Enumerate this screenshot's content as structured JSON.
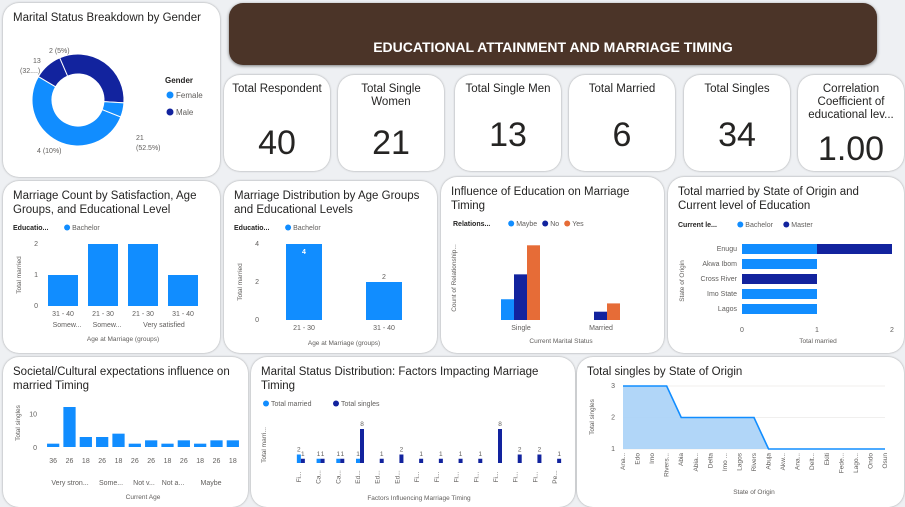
{
  "header": {
    "title": "EDUCATIONAL ATTAINMENT AND MARRIAGE TIMING"
  },
  "kpis": [
    {
      "label": "Total Respondent",
      "value": "40"
    },
    {
      "label": "Total Single Women",
      "value": "21"
    },
    {
      "label": "Total Single Men",
      "value": "13"
    },
    {
      "label": "Total Married",
      "value": "6"
    },
    {
      "label": "Total Singles",
      "value": "34"
    },
    {
      "label": "Correlation Coefficient of educational lev...",
      "value": "1.00"
    }
  ],
  "colors": {
    "light": "#118dff",
    "dark": "#12239e",
    "orange": "#e66c37",
    "banner": "#4b3428",
    "area_fill": "#a9d2f7"
  },
  "chart_data": [
    {
      "id": "donut",
      "type": "pie",
      "title": "Marital Status Breakdown by Gender",
      "legend_title": "Gender",
      "slices": [
        {
          "label": "Female",
          "value": 21,
          "pct": "52.5%",
          "color": "#118dff"
        },
        {
          "label": "Male",
          "value": 13,
          "pct": "32....",
          "color": "#12239e"
        },
        {
          "label": "",
          "value": 4,
          "pct": "10%",
          "color": "#12239e"
        },
        {
          "label": "",
          "value": 2,
          "pct": "5%",
          "color": "#118dff"
        }
      ],
      "data_labels": [
        "2 (5%)",
        "13",
        "(32....)",
        "4 (10%)",
        "21",
        "(52.5%)"
      ]
    },
    {
      "id": "satisfaction",
      "type": "bar",
      "title": "Marriage Count by Satisfaction, Age Groups, and Educational Level",
      "legend_title": "Educatio...",
      "series_names": [
        "Bachelor"
      ],
      "categories": [
        "31 - 40",
        "21 - 30",
        "21 - 30",
        "31 - 40"
      ],
      "group_labels": [
        "Somew...",
        "Somew...",
        "Very satisfied"
      ],
      "values": [
        1,
        2,
        2,
        1
      ],
      "ylim": [
        0,
        2
      ],
      "yticks": [
        "0",
        "1",
        "2"
      ],
      "ylabel": "Total married",
      "xlabel": "Age at Marriage (groups)"
    },
    {
      "id": "distribution",
      "type": "bar",
      "title": "Marriage Distribution by Age Groups and Educational Levels",
      "legend_title": "Educatio...",
      "series_names": [
        "Bachelor"
      ],
      "categories": [
        "21 - 30",
        "31 - 40"
      ],
      "values": [
        4,
        2
      ],
      "ylim": [
        0,
        4
      ],
      "yticks": [
        "0",
        "2",
        "4"
      ],
      "ylabel": "Total married",
      "xlabel": "Age at Marriage (groups)"
    },
    {
      "id": "influence",
      "type": "bar",
      "title": "Influence of Education on Marriage Timing",
      "legend_title": "Relations...",
      "categories": [
        "Single",
        "Married"
      ],
      "series": [
        {
          "name": "Maybe",
          "values": [
            5,
            0
          ],
          "color": "#118dff"
        },
        {
          "name": "No",
          "values": [
            11,
            2
          ],
          "color": "#12239e"
        },
        {
          "name": "Yes",
          "values": [
            18,
            4
          ],
          "color": "#e66c37"
        }
      ],
      "ylim": [
        0,
        20
      ],
      "ylabel": "Count of Relationship...",
      "xlabel": "Current Marital Status"
    },
    {
      "id": "state_married",
      "type": "bar",
      "title": "Total married by State of Origin and Current level of Education",
      "legend_title": "Current le...",
      "categories": [
        "Enugu",
        "Akwa Ibom",
        "Cross River",
        "Imo State",
        "Lagos"
      ],
      "series": [
        {
          "name": "Bachelor",
          "values": [
            1,
            1,
            0,
            1,
            1
          ],
          "color": "#118dff"
        },
        {
          "name": "Master",
          "values": [
            1,
            0,
            1,
            0,
            0
          ],
          "color": "#12239e"
        }
      ],
      "xlim": [
        0,
        2
      ],
      "xticks": [
        "0",
        "1",
        "2"
      ],
      "xlabel": "Total married",
      "ylabel": "State of Origin"
    },
    {
      "id": "societal",
      "type": "bar",
      "title": "Societal/Cultural expectations influence on married Timing",
      "ylabel": "Total singles",
      "xlabel": "Current Age",
      "categories": [
        "36",
        "26",
        "18",
        "26",
        "18",
        "26",
        "26",
        "18",
        "26",
        "18",
        "26",
        "18"
      ],
      "values": [
        1,
        12,
        3,
        3,
        4,
        1,
        2,
        1,
        2,
        1,
        2,
        2
      ],
      "group_labels": [
        "Very stron...",
        "Some...",
        "Not v...",
        "Not a...",
        "Maybe"
      ],
      "ylim": [
        0,
        10
      ],
      "yticks": [
        "0",
        "10"
      ]
    },
    {
      "id": "factors",
      "type": "bar",
      "title": "Marital Status Distribution: Factors Impacting Marriage Timing",
      "ylabel": "Total marri...",
      "xlabel": "Factors Influencing Marriage Timing",
      "categories": [
        "Fi...",
        "Ca...",
        "Ca...",
        "Ed...",
        "Ed...",
        "Ed...",
        "Fi...",
        "Fi...",
        "Fi...",
        "Fi...",
        "Fi...",
        "Fi...",
        "Fi...",
        "Pe..."
      ],
      "series": [
        {
          "name": "Total married",
          "values": [
            2,
            1,
            1,
            1,
            0,
            0,
            0,
            0,
            0,
            0,
            0,
            0,
            0,
            0
          ],
          "color": "#118dff"
        },
        {
          "name": "Total singles",
          "values": [
            1,
            1,
            1,
            8,
            1,
            2,
            1,
            1,
            1,
            1,
            8,
            2,
            2,
            1
          ],
          "color": "#12239e"
        }
      ],
      "data_labels": [
        "2",
        "1",
        "1",
        "1",
        "1",
        "8",
        "1",
        "2",
        "1",
        "1",
        "1",
        "1",
        "1",
        "8",
        "2",
        "2",
        "1"
      ],
      "ylim": [
        0,
        8
      ]
    },
    {
      "id": "singles_state",
      "type": "area",
      "title": "Total singles by State of Origin",
      "ylabel": "Total singles",
      "xlabel": "State of Origin",
      "categories": [
        "Ana...",
        "Edo",
        "Imo",
        "Rivers...",
        "Abia",
        "Abia...",
        "Delta",
        "Imo ...",
        "Lagos",
        "Rivers",
        "Abuja",
        "Akw...",
        "Ana...",
        "Delt...",
        "Ekiti",
        "Fede...",
        "Lago...",
        "Ondo",
        "Osun"
      ],
      "values": [
        3,
        3,
        3,
        3,
        2,
        2,
        2,
        2,
        2,
        2,
        1,
        1,
        1,
        1,
        1,
        1,
        1,
        1,
        1
      ],
      "ylim": [
        1,
        3
      ],
      "yticks": [
        "1",
        "2",
        "3"
      ]
    }
  ]
}
